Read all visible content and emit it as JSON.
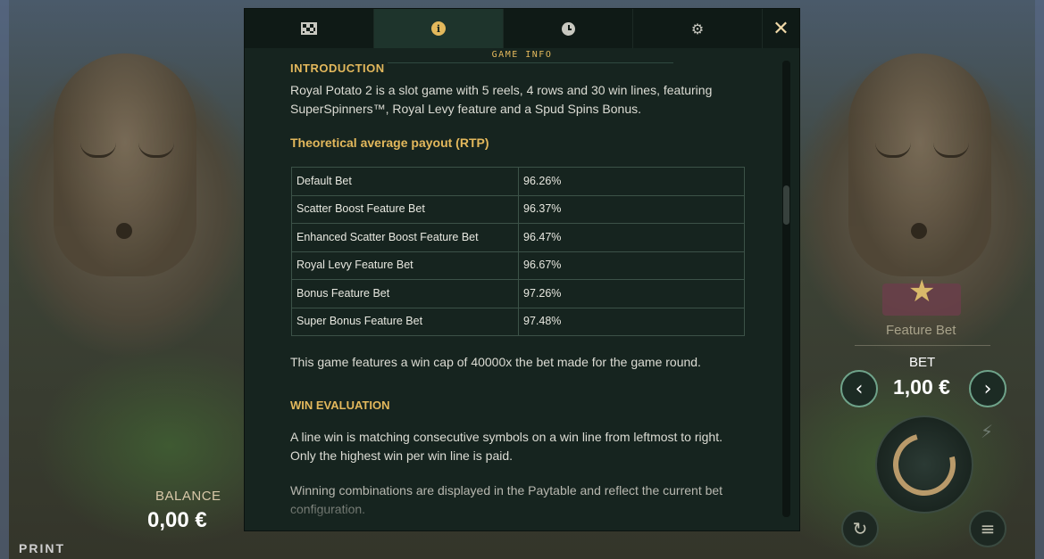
{
  "background": {
    "balance_label": "BALANCE",
    "balance_value": "0,00 €",
    "logo": "PRINT",
    "feature_bet_label": "Feature Bet",
    "bet_label": "BET",
    "bet_value": "1,00 €"
  },
  "modal": {
    "tabs": [
      {
        "icon": "paytable-grid-icon"
      },
      {
        "icon": "info-icon",
        "glyph": "i",
        "active": true
      },
      {
        "icon": "history-clock-icon"
      },
      {
        "icon": "settings-gear-icon",
        "glyph": "⚙"
      }
    ],
    "close_glyph": "✕",
    "title": "GAME INFO",
    "intro_heading": "INTRODUCTION",
    "intro_text": "Royal Potato 2 is a slot game with 5 reels, 4 rows and 30 win lines, featuring SuperSpinners™, Royal Levy feature and a Spud Spins Bonus.",
    "rtp_heading": "Theoretical average payout (RTP)",
    "rtp_rows": [
      {
        "name": "Default Bet",
        "value": "96.26%"
      },
      {
        "name": "Scatter Boost Feature Bet",
        "value": "96.37%"
      },
      {
        "name": "Enhanced Scatter Boost Feature Bet",
        "value": "96.47%"
      },
      {
        "name": "Royal Levy Feature Bet",
        "value": "96.67%"
      },
      {
        "name": "Bonus Feature Bet",
        "value": "97.26%"
      },
      {
        "name": "Super Bonus Feature Bet",
        "value": "97.48%"
      }
    ],
    "win_cap_text": "This game features a win cap of 40000x the bet made for the game round.",
    "win_eval_heading": "WIN EVALUATION",
    "win_eval_text": "A line win is matching consecutive symbols on a win line from leftmost to right. Only the highest win per win line is paid.",
    "win_combo_text": "Winning combinations are displayed in the Paytable and reflect the current bet configuration."
  },
  "colors": {
    "accent_gold": "#e3b85c",
    "modal_bg": "#16241f"
  }
}
